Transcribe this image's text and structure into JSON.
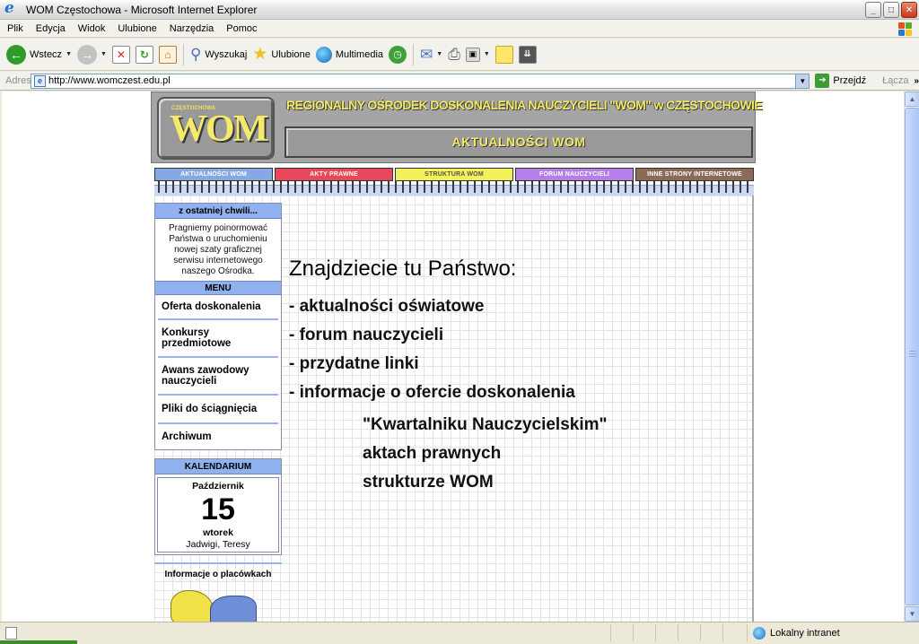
{
  "window": {
    "title": "WOM Częstochowa - Microsoft Internet Explorer",
    "controls": {
      "minimize": "_",
      "maximize": "□",
      "close": "✕"
    }
  },
  "menubar": {
    "items": [
      "Plik",
      "Edycja",
      "Widok",
      "Ulubione",
      "Narzędzia",
      "Pomoc"
    ]
  },
  "toolbar": {
    "back_label": "Wstecz",
    "search_label": "Wyszukaj",
    "favorites_label": "Ulubione",
    "media_label": "Multimedia"
  },
  "addressbar": {
    "label": "Adres",
    "url": "http://www.womczest.edu.pl",
    "go_label": "Przejdź",
    "links_label": "Łącza",
    "links_chevron": "»"
  },
  "site": {
    "logo_small": "CZĘSTOCHOWA",
    "logo_big": "WOM",
    "org_title": "REGIONALNY OŚRODEK DOSKONALENIA NAUCZYCIELI \"WOM\" w CZĘSTOCHOWIE",
    "banner": "AKTUALNOŚCI WOM",
    "nav": [
      "AKTUALNOŚCI WOM",
      "AKTY PRAWNE",
      "STRUKTURA WOM",
      "FORUM NAUCZYCIELI",
      "INNE STRONY INTERNETOWE"
    ],
    "flash": {
      "heading": "z ostatniej chwili...",
      "text": "Pragniemy poinormować Państwa o uruchomieniu nowej szaty graficznej serwisu internetowego naszego Ośrodka."
    },
    "menu": {
      "heading": "MENU",
      "items": [
        "Oferta doskonalenia",
        "Konkursy przedmiotowe",
        "Awans zawodowy nauczycieli",
        "Pliki do ściągnięcia",
        "Archiwum"
      ]
    },
    "calendar": {
      "heading": "KALENDARIUM",
      "month": "Październik",
      "day": "15",
      "weekday": "wtorek",
      "names": "Jadwigi, Teresy"
    },
    "branches_title": "Informacje o placówkach",
    "main": {
      "heading": "Znajdziecie tu Państwo:",
      "bullets": [
        "- aktualności oświatowe",
        "- forum nauczycieli",
        "- przydatne linki",
        "- informacje o ofercie doskonalenia"
      ],
      "subitems": [
        "\"Kwartalniku Nauczycielskim\"",
        "aktach prawnych",
        "strukturze WOM"
      ]
    }
  },
  "statusbar": {
    "zone": "Lokalny intranet"
  },
  "colors": {
    "header_gray": "#a5a5a5",
    "logo_yellow": "#f4ea63",
    "tab_blue": "#86a9e6",
    "tab_red": "#e8475c",
    "tab_yellow": "#f4f05a",
    "tab_purple": "#b77ee8",
    "tab_brown": "#8c6a58",
    "panel_blue": "#8fb1ee"
  }
}
